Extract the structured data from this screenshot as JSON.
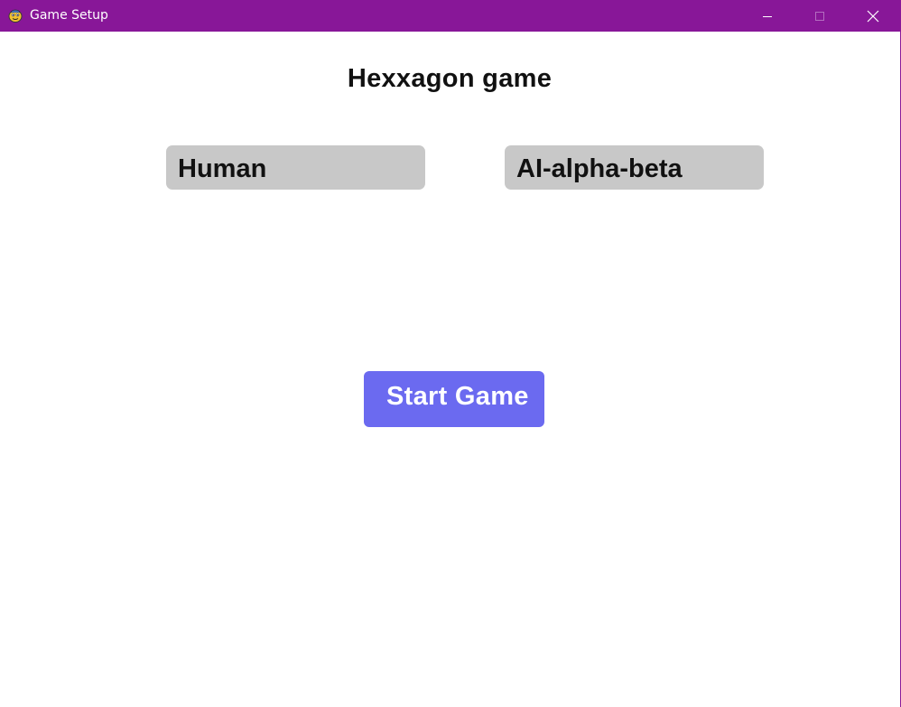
{
  "window": {
    "title": "Game Setup",
    "titlebar_color": "#881798",
    "app_icon": "python-snake-icon",
    "controls": {
      "minimize_icon": "minimize-icon",
      "maximize_icon": "maximize-icon",
      "close_icon": "close-icon"
    }
  },
  "main": {
    "heading": "Hexxagon game",
    "player_one": "Human",
    "player_two": "AI-alpha-beta",
    "start_button": "Start Game",
    "colors": {
      "player_box": "#c8c8c8",
      "start_button": "#6b6af0"
    }
  }
}
